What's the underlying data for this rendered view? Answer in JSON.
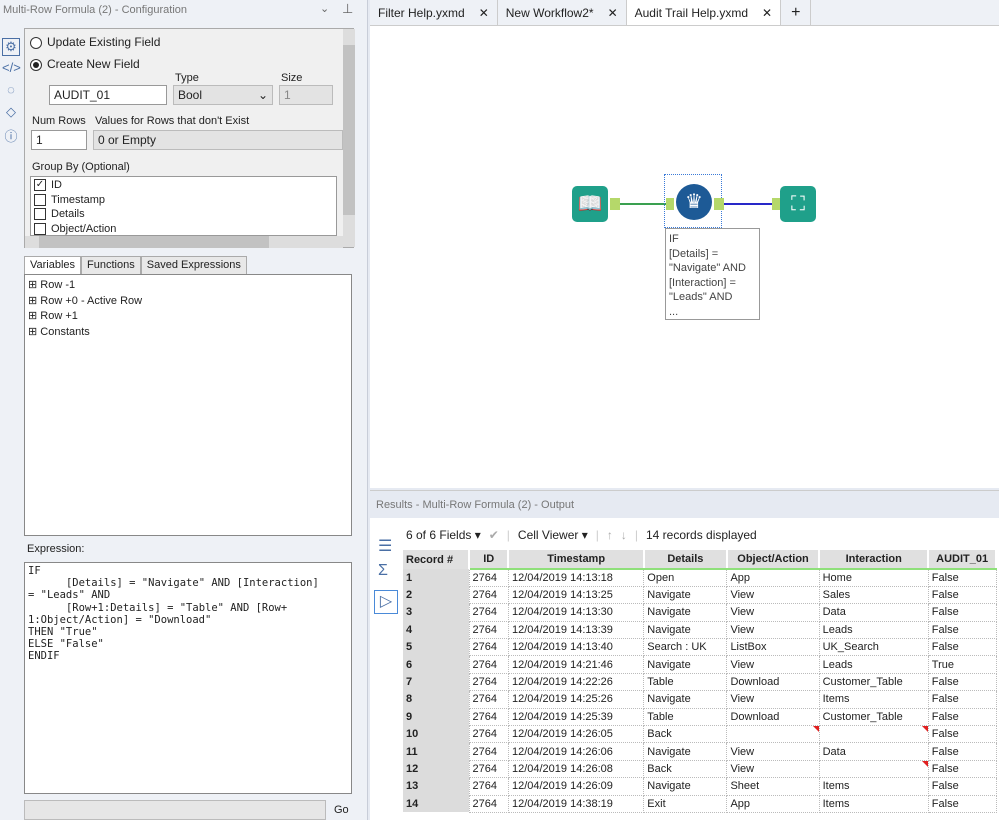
{
  "config": {
    "title": "Multi-Row Formula (2) - Configuration",
    "update_label": "Update Existing Field",
    "create_label": "Create New  Field",
    "field_name": "AUDIT_01",
    "type_label": "Type",
    "type_value": "Bool",
    "size_label": "Size",
    "size_value": "1",
    "num_rows_label": "Num Rows",
    "num_rows_value": "1",
    "nonexist_label": "Values for Rows that don't Exist",
    "nonexist_value": "0 or Empty",
    "group_by_label": "Group By (Optional)",
    "group_by": [
      {
        "label": "ID",
        "checked": true
      },
      {
        "label": "Timestamp",
        "checked": false
      },
      {
        "label": "Details",
        "checked": false
      },
      {
        "label": "Object/Action",
        "checked": false
      }
    ]
  },
  "tabs": [
    "Variables",
    "Functions",
    "Saved Expressions"
  ],
  "tree": [
    "Row -1",
    "Row +0 - Active Row",
    "Row +1",
    "Constants"
  ],
  "expression_label": "Expression:",
  "expression": "IF\n\t[Details] = \"Navigate\" AND [Interaction]\n= \"Leads\" AND\n\t[Row+1:Details] = \"Table\" AND [Row+\n1:Object/Action] = \"Download\"\nTHEN \"True\"\nELSE \"False\"\nENDIF",
  "go_label": "Go",
  "workflow_tabs": [
    {
      "label": "Filter Help.yxmd",
      "active": false
    },
    {
      "label": "New Workflow2*",
      "active": false
    },
    {
      "label": "Audit Trail Help.yxmd",
      "active": true
    }
  ],
  "annotation": "IF\n[Details] =\n\"Navigate\" AND\n[Interaction] =\n\"Leads\" AND\n...",
  "results": {
    "title": "Results - Multi-Row Formula (2) - Output",
    "fields": "6 of 6 Fields",
    "viewer": "Cell Viewer",
    "count": "14 records displayed",
    "columns": [
      "Record #",
      "ID",
      "Timestamp",
      "Details",
      "Object/Action",
      "Interaction",
      "AUDIT_01"
    ],
    "rows": [
      [
        "1",
        "2764",
        "12/04/2019 14:13:18",
        "Open",
        "App",
        "Home",
        "False"
      ],
      [
        "2",
        "2764",
        "12/04/2019 14:13:25",
        "Navigate",
        "View",
        "Sales",
        "False"
      ],
      [
        "3",
        "2764",
        "12/04/2019 14:13:30",
        "Navigate",
        "View",
        "Data",
        "False"
      ],
      [
        "4",
        "2764",
        "12/04/2019 14:13:39",
        "Navigate",
        "View",
        "Leads",
        "False"
      ],
      [
        "5",
        "2764",
        "12/04/2019 14:13:40",
        "Search : UK",
        "ListBox",
        "UK_Search",
        "False"
      ],
      [
        "6",
        "2764",
        "12/04/2019 14:21:46",
        "Navigate",
        "View",
        "Leads",
        "True"
      ],
      [
        "7",
        "2764",
        "12/04/2019 14:22:26",
        "Table",
        "Download",
        "Customer_Table",
        "False"
      ],
      [
        "8",
        "2764",
        "12/04/2019 14:25:26",
        "Navigate",
        "View",
        "Items",
        "False"
      ],
      [
        "9",
        "2764",
        "12/04/2019 14:25:39",
        "Table",
        "Download",
        "Customer_Table",
        "False"
      ],
      [
        "10",
        "2764",
        "12/04/2019 14:26:05",
        "Back",
        "",
        "",
        "False"
      ],
      [
        "11",
        "2764",
        "12/04/2019 14:26:06",
        "Navigate",
        "View",
        "Data",
        "False"
      ],
      [
        "12",
        "2764",
        "12/04/2019 14:26:08",
        "Back",
        "View",
        "",
        "False"
      ],
      [
        "13",
        "2764",
        "12/04/2019 14:26:09",
        "Navigate",
        "Sheet",
        "Items",
        "False"
      ],
      [
        "14",
        "2764",
        "12/04/2019 14:38:19",
        "Exit",
        "App",
        "Items",
        "False"
      ]
    ]
  }
}
